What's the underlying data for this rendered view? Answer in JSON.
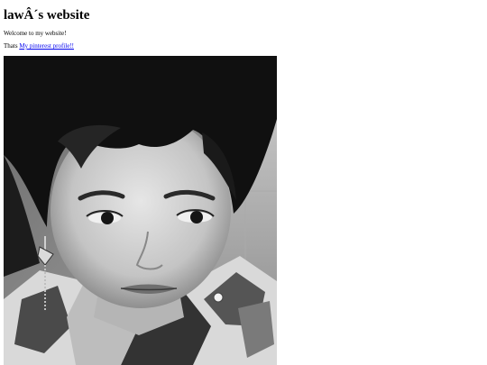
{
  "page": {
    "title": "lawÂ´s website",
    "welcome_text": "Welcome to my website!",
    "link_prefix": "Thats",
    "link_text": "My pinterest profile!!"
  },
  "photo": {
    "content": "grayscale selfie portrait"
  },
  "colors": {
    "link": "#0000ee",
    "text": "#000000",
    "background": "#ffffff"
  }
}
